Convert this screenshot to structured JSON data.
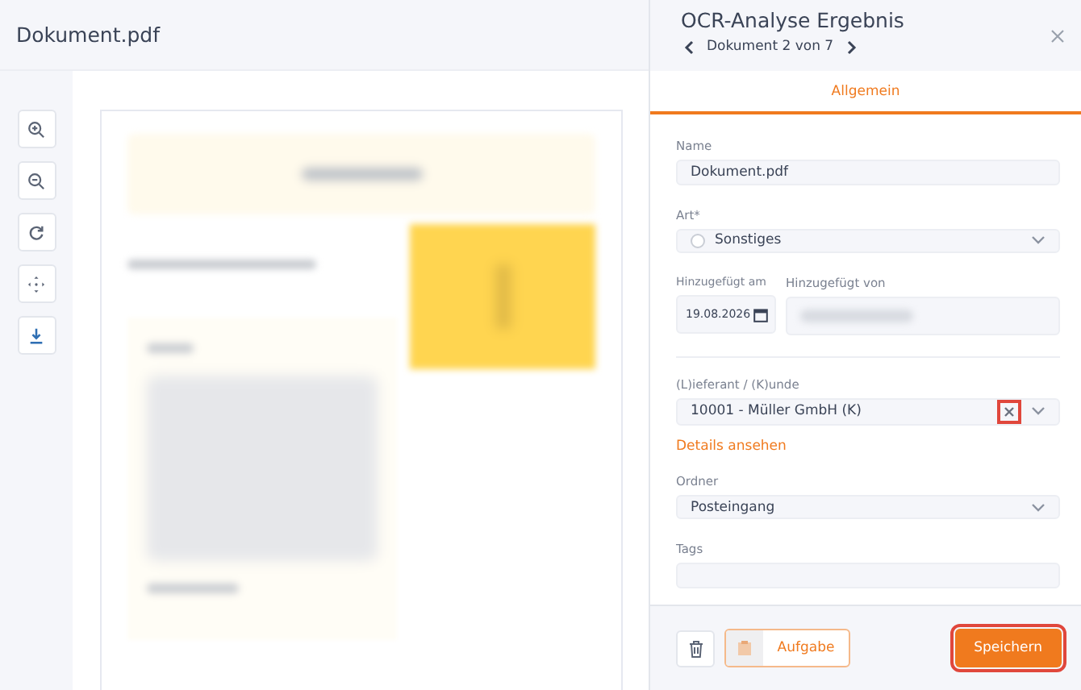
{
  "viewer": {
    "title": "Dokument.pdf",
    "tools": [
      {
        "kind": "zoom-in"
      },
      {
        "kind": "zoom-out"
      },
      {
        "kind": "rotate"
      },
      {
        "kind": "fit"
      },
      {
        "kind": "download"
      }
    ]
  },
  "panel": {
    "title": "OCR-Analyse Ergebnis",
    "nav": "Dokument 2 von 7"
  },
  "tabs": [
    {
      "label": "Allgemein",
      "selected": true
    }
  ],
  "form": {
    "name": {
      "label": "Name",
      "value": "Dokument.pdf"
    },
    "type": {
      "label": "Art*",
      "value": "Sonstiges"
    },
    "added_on": {
      "label": "Hinzugefügt am",
      "value": "19.08.2026"
    },
    "added_by": {
      "label": "Hinzugefügt von"
    },
    "partner": {
      "label": "(L)ieferant / (K)unde",
      "value": "10001 - Müller GmbH (K)",
      "clear_highlighted": true
    },
    "details_link": "Details ansehen",
    "folder": {
      "label": "Ordner",
      "value": "Posteingang"
    },
    "tags": {
      "label": "Tags"
    }
  },
  "footer": {
    "task_button": "Aufgabe",
    "save_button": "Speichern",
    "save_highlighted": true
  }
}
